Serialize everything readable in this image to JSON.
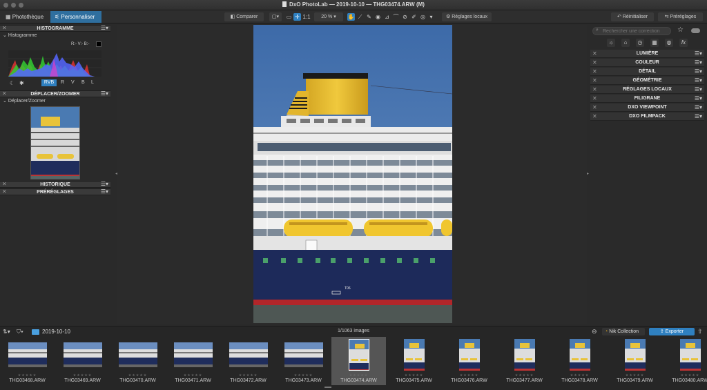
{
  "window": {
    "title": "DxO PhotoLab — 2019-10-10 — THG03474.ARW (M)"
  },
  "tabs": [
    {
      "label": "Photothèque"
    },
    {
      "label": "Personnaliser"
    }
  ],
  "toolbar": {
    "compare_label": "Comparer",
    "zoom_fit": "1:1",
    "zoom_level": "20 %",
    "local_adjust_label": "Réglages locaux",
    "reset_label": "Réinitialiser",
    "presets_label": "Préréglages"
  },
  "left": {
    "histogram": {
      "header": "HISTOGRAMME",
      "sub": "Histogramme",
      "rgb_readout": "R:- V:- B:-",
      "channels": [
        "RVB",
        "R",
        "V",
        "B",
        "L"
      ]
    },
    "move_zoom": {
      "header": "DÉPLACER/ZOOMER",
      "sub": "Déplacer/Zoomer"
    },
    "history": {
      "header": "HISTORIQUE"
    },
    "presets": {
      "header": "PRÉRÉGLAGES"
    }
  },
  "right": {
    "search_placeholder": "Rechercher une correction",
    "sections": [
      {
        "label": "LUMIÈRE"
      },
      {
        "label": "COULEUR"
      },
      {
        "label": "DÉTAIL"
      },
      {
        "label": "GÉOMÉTRIE"
      },
      {
        "label": "RÉGLAGES LOCAUX"
      },
      {
        "label": "FILIGRANE"
      },
      {
        "label": "DXO VIEWPOINT"
      },
      {
        "label": "DXO FILMPACK"
      }
    ]
  },
  "photo": {
    "hull_text": "T06"
  },
  "filmstrip_bar": {
    "folder": "2019-10-10",
    "count": "1/1063 images",
    "nik_label": "Nik Collection",
    "export_label": "Exporter"
  },
  "thumbs": [
    {
      "name": "THG03468.ARW",
      "orient": "h"
    },
    {
      "name": "THG03469.ARW",
      "orient": "h"
    },
    {
      "name": "THG03470.ARW",
      "orient": "h"
    },
    {
      "name": "THG03471.ARW",
      "orient": "h"
    },
    {
      "name": "THG03472.ARW",
      "orient": "h"
    },
    {
      "name": "THG03473.ARW",
      "orient": "h"
    },
    {
      "name": "THG03474.ARW",
      "orient": "v",
      "selected": true
    },
    {
      "name": "THG03475.ARW",
      "orient": "v"
    },
    {
      "name": "THG03476.ARW",
      "orient": "v"
    },
    {
      "name": "THG03477.ARW",
      "orient": "v"
    },
    {
      "name": "THG03478.ARW",
      "orient": "v"
    },
    {
      "name": "THG03479.ARW",
      "orient": "v"
    },
    {
      "name": "THG03480.ARW",
      "orient": "v"
    }
  ]
}
